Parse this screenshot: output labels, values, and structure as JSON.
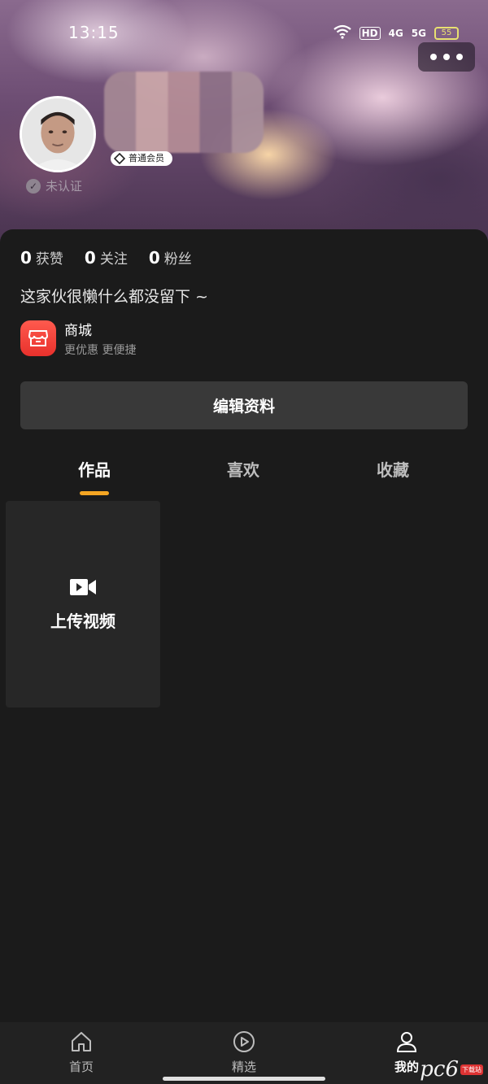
{
  "status_bar": {
    "time": "13:15",
    "net_4g": "4G",
    "net_5g": "5G",
    "hd": "HD",
    "battery": "55"
  },
  "profile": {
    "member_badge": "普通会员",
    "verify_status": "未认证",
    "bio": "这家伙很懒什么都没留下 ~"
  },
  "stats": [
    {
      "count": "0",
      "label": "获赞"
    },
    {
      "count": "0",
      "label": "关注"
    },
    {
      "count": "0",
      "label": "粉丝"
    }
  ],
  "mall": {
    "title": "商城",
    "subtitle": "更优惠 更便捷"
  },
  "edit_button_label": "编辑资料",
  "tabs": [
    {
      "label": "作品",
      "active": true
    },
    {
      "label": "喜欢",
      "active": false
    },
    {
      "label": "收藏",
      "active": false
    }
  ],
  "upload_card_label": "上传视频",
  "bottom_nav": [
    {
      "label": "首页",
      "icon": "home-icon",
      "active": false
    },
    {
      "label": "精选",
      "icon": "play-circle-icon",
      "active": false
    },
    {
      "label": "我的",
      "icon": "user-icon",
      "active": true
    }
  ],
  "watermark": {
    "text": "pc6",
    "sub": "下载站"
  },
  "colors": {
    "background": "#1b1b1b",
    "accent": "#f5a623",
    "mall_red": "#e8312c",
    "edit_button": "#393939"
  }
}
